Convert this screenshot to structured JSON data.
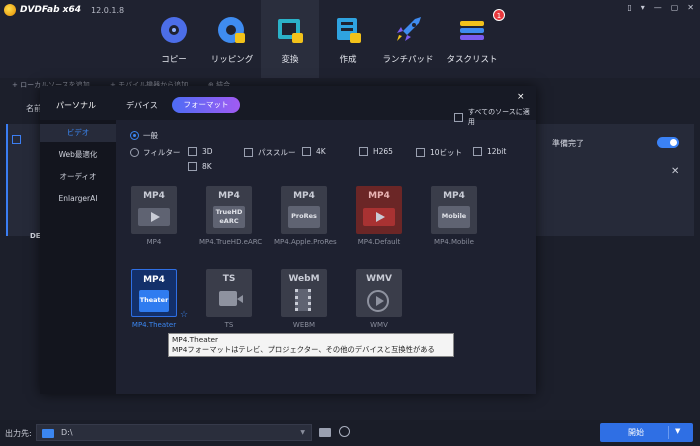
{
  "app": {
    "name": "DVDFab x64",
    "version": "12.0.1.8"
  },
  "nav": [
    {
      "label": "コピー",
      "icon": "disc-copy-icon",
      "active": false
    },
    {
      "label": "リッピング",
      "icon": "disc-ripper-icon",
      "active": false
    },
    {
      "label": "変換",
      "icon": "video-converter-icon",
      "active": true
    },
    {
      "label": "作成",
      "icon": "disc-creator-icon",
      "active": false
    },
    {
      "label": "ランチパッド",
      "icon": "rocket-icon",
      "active": false
    },
    {
      "label": "タスクリスト",
      "icon": "task-list-icon",
      "active": false,
      "badge": "1"
    }
  ],
  "background": {
    "toolbar": [
      "ローカルソースを追加",
      "モバイル機器から追加",
      "結合"
    ],
    "list_head": "名前",
    "status": "準備完了",
    "card_tag": "DE"
  },
  "modal": {
    "tabs": {
      "personal": "パーソナル",
      "device": "デバイス",
      "format": "フォーマット"
    },
    "apply_all": "すべてのソースに適用",
    "close": "×",
    "sidebar": [
      "ビデオ",
      "Web最適化",
      "オーディオ",
      "EnlargerAI"
    ],
    "sidebar_active": 0,
    "options": {
      "general": "一般",
      "filter": "フィルター",
      "filters": [
        "3D",
        "パススルー",
        "4K",
        "H265",
        "10ビット",
        "12bit",
        "8K"
      ]
    },
    "formats": [
      {
        "title": "MP4",
        "sub": "",
        "label": "MP4",
        "style": "play"
      },
      {
        "title": "MP4",
        "sub": "TrueHD eARC",
        "label": "MP4.TrueHD.eARC",
        "style": "text"
      },
      {
        "title": "MP4",
        "sub": "ProRes",
        "label": "MP4.Apple.ProRes",
        "style": "text"
      },
      {
        "title": "MP4",
        "sub": "",
        "label": "MP4.Default",
        "style": "red"
      },
      {
        "title": "MP4",
        "sub": "Mobile",
        "label": "MP4.Mobile",
        "style": "text"
      },
      {
        "title": "MP4",
        "sub": "Theater",
        "label": "MP4.Theater",
        "style": "theater"
      },
      {
        "title": "TS",
        "sub": "",
        "label": "TS",
        "style": "camera"
      },
      {
        "title": "WebM",
        "sub": "",
        "label": "WEBM",
        "style": "film"
      },
      {
        "title": "WMV",
        "sub": "",
        "label": "WMV",
        "style": "circle"
      }
    ],
    "tooltip": {
      "title": "MP4.Theater",
      "desc": "MP4フォーマットはテレビ、プロジェクター、その他のデバイスと互換性がある"
    }
  },
  "bottom": {
    "output_label": "出力先:",
    "path": "D:\\",
    "start": "開始"
  },
  "colors": {
    "accent": "#3b86f0",
    "start_button": "#2f6fe4",
    "badge": "#e8383d"
  }
}
